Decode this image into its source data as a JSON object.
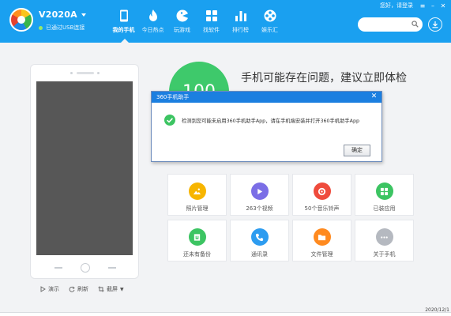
{
  "header": {
    "device_name": "V2020A",
    "connection_status": "已通过USB连接",
    "nav": [
      {
        "label": "我的手机",
        "icon": "phone-icon",
        "active": true
      },
      {
        "label": "今日热点",
        "icon": "flame-icon",
        "active": false
      },
      {
        "label": "玩游戏",
        "icon": "game-icon",
        "active": false
      },
      {
        "label": "找软件",
        "icon": "apps-icon",
        "active": false
      },
      {
        "label": "排行榜",
        "icon": "bar-chart-icon",
        "active": false
      },
      {
        "label": "娱乐汇",
        "icon": "film-icon",
        "active": false
      }
    ],
    "login_label": "您好，请登录",
    "search_placeholder": "",
    "brand_color": "#1aa0f0"
  },
  "phone_tools": [
    {
      "label": "演示",
      "icon": "play-icon"
    },
    {
      "label": "刷新",
      "icon": "refresh-icon"
    },
    {
      "label": "截屏",
      "icon": "crop-icon"
    }
  ],
  "score": {
    "value": "100",
    "color": "#3ec96b"
  },
  "health_title": "手机可能存在问题，建议立即体检",
  "tools": [
    {
      "label": "照片管理",
      "icon": "photo-icon",
      "color": "#f7b500"
    },
    {
      "label": "263个视频",
      "icon": "video-icon",
      "color": "#7b6ee6"
    },
    {
      "label": "50个音乐铃声",
      "icon": "music-icon",
      "color": "#ef4b3c"
    },
    {
      "label": "已装应用",
      "icon": "apps-icon",
      "color": "#3cc462"
    },
    {
      "label": "还未有备份",
      "icon": "backup-icon",
      "color": "#3cc462"
    },
    {
      "label": "通讯录",
      "icon": "phone-call-icon",
      "color": "#2d9cf0"
    },
    {
      "label": "文件管理",
      "icon": "folder-icon",
      "color": "#ff8a1f"
    },
    {
      "label": "关于手机",
      "icon": "more-icon",
      "color": "#b5b9c0"
    }
  ],
  "dialog": {
    "title": "360手机助手",
    "message": "检测到您可能未启用360手机助手App，请在手机端安装并打开360手机助手App",
    "ok_label": "确定"
  },
  "clock": "2020/12/1"
}
